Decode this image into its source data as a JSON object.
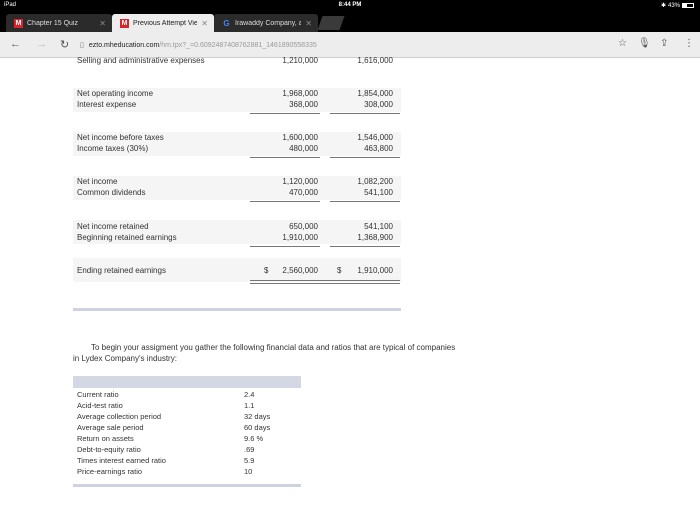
{
  "status_bar": {
    "device": "iPad",
    "time": "8:44 PM",
    "battery": "43%"
  },
  "tabs": [
    {
      "label": "Chapter 15 Quiz",
      "icon": "mcgraw-m-icon",
      "active": false
    },
    {
      "label": "Previous Attempt View",
      "icon": "mcgraw-m-icon",
      "active": true
    },
    {
      "label": "Irawaddy Company, a",
      "icon": "google-g-icon",
      "active": false
    }
  ],
  "address": {
    "domain": "ezto.mheducation.com",
    "path": "/hm.tpx?_=0.6092487408762881_1461890558335"
  },
  "statement": {
    "partial_row": {
      "label": "Selling and administrative expenses",
      "v1": "1,210,000",
      "v2": "1,616,000"
    },
    "rows": [
      {
        "label": "Net operating income",
        "v1": "1,968,000",
        "v2": "1,854,000"
      },
      {
        "label": "Interest expense",
        "v1": "368,000",
        "v2": "308,000"
      },
      {
        "label": "Net income before taxes",
        "v1": "1,600,000",
        "v2": "1,546,000"
      },
      {
        "label": "Income taxes (30%)",
        "v1": "480,000",
        "v2": "463,800"
      },
      {
        "label": "Net income",
        "v1": "1,120,000",
        "v2": "1,082,200"
      },
      {
        "label": "Common dividends",
        "v1": "470,000",
        "v2": "541,100"
      },
      {
        "label": "Net income retained",
        "v1": "650,000",
        "v2": "541,100"
      },
      {
        "label": "Beginning retained earnings",
        "v1": "1,910,000",
        "v2": "1,368,900"
      }
    ],
    "ending": {
      "label": "Ending retained earnings",
      "currency": "$",
      "v1": "2,560,000",
      "v2": "1,910,000"
    }
  },
  "intro": {
    "line1": "To begin your assigment you gather the following financial data and ratios that are typical of companies",
    "line2": "in Lydex Company's industry:"
  },
  "ratios": [
    {
      "label": "Current ratio",
      "value": "2.4"
    },
    {
      "label": "Acid-test ratio",
      "value": "1.1"
    },
    {
      "label": "Average collection period",
      "value": "32 days"
    },
    {
      "label": "Average sale period",
      "value": "60 days"
    },
    {
      "label": "Return on assets",
      "value": "9.6 %"
    },
    {
      "label": "Debt-to-equity ratio",
      "value": ".69"
    },
    {
      "label": "Times interest earned ratio",
      "value": "5.9"
    },
    {
      "label": "Price-earnings ratio",
      "value": "10"
    }
  ]
}
